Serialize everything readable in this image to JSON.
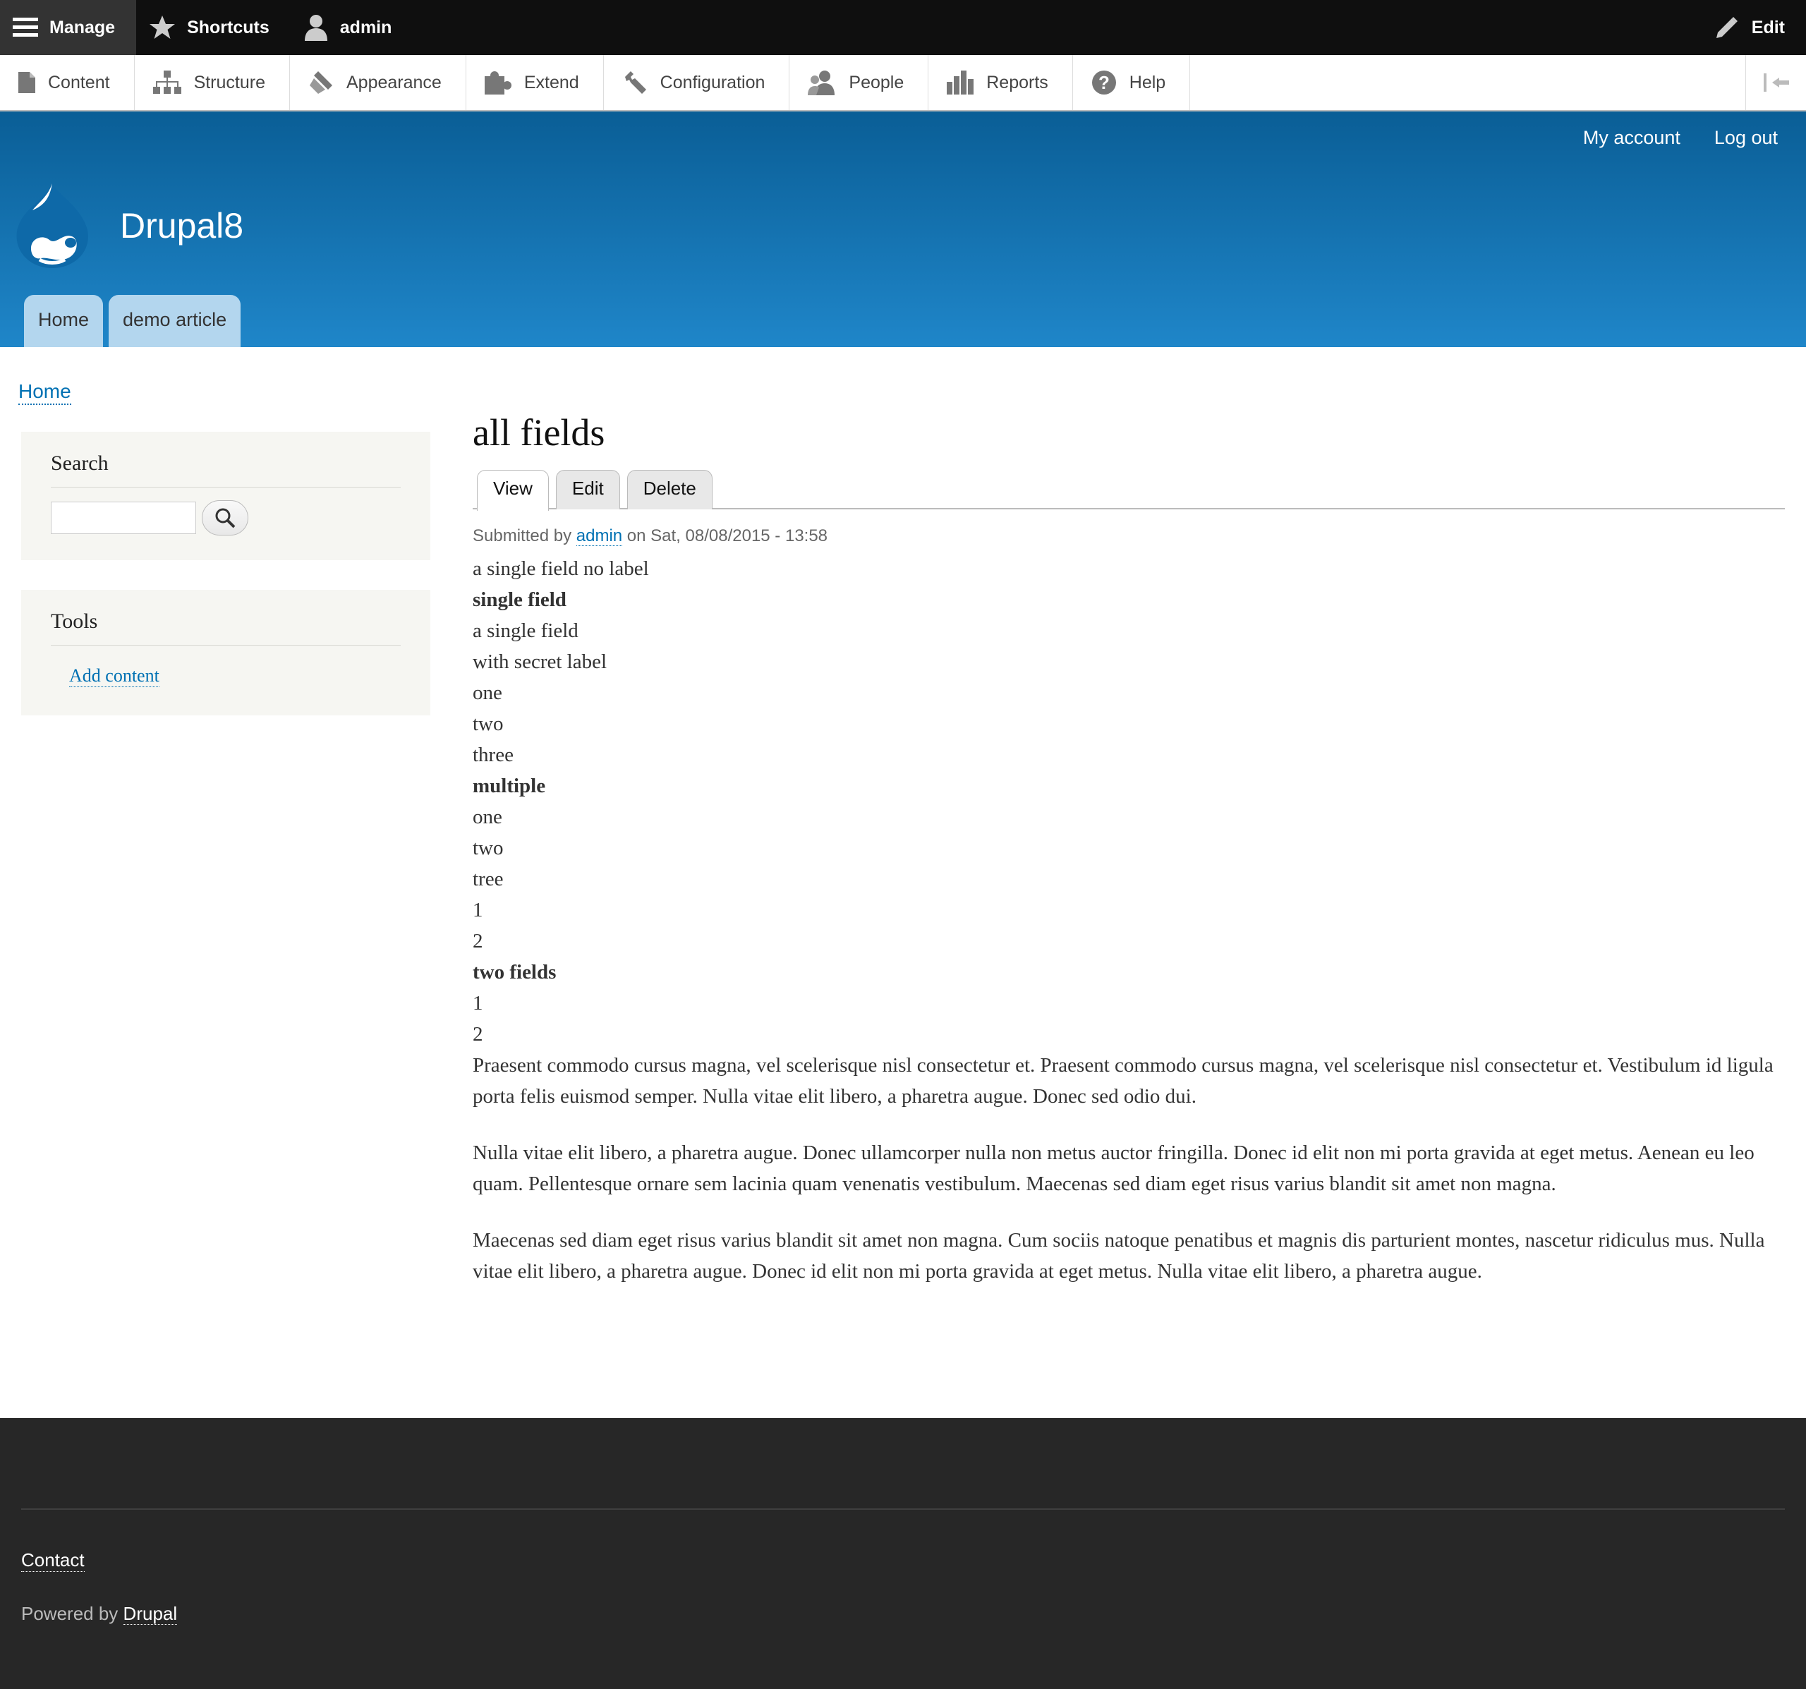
{
  "toolbar": {
    "manage": "Manage",
    "shortcuts": "Shortcuts",
    "user": "admin",
    "edit": "Edit"
  },
  "tray": {
    "items": [
      "Content",
      "Structure",
      "Appearance",
      "Extend",
      "Configuration",
      "People",
      "Reports",
      "Help"
    ]
  },
  "header": {
    "secondary_menu": [
      "My account",
      "Log out"
    ],
    "site_name": "Drupal8",
    "main_menu": [
      "Home",
      "demo article"
    ]
  },
  "breadcrumb": "Home",
  "sidebar": {
    "search_title": "Search",
    "search_value": "",
    "tools_title": "Tools",
    "tools_link": "Add content"
  },
  "main": {
    "title": "all fields",
    "tabs": [
      "View",
      "Edit",
      "Delete"
    ],
    "submitted_prefix": "Submitted by",
    "submitted_author": "admin",
    "submitted_suffix": "on Sat, 08/08/2015 - 13:58",
    "fields": [
      "a single field no label",
      "single field",
      "a single field",
      "with secret label",
      "one",
      "two",
      "three",
      "multiple",
      "one",
      "two",
      "tree",
      "1",
      "2",
      "two fields",
      "1",
      "2"
    ],
    "paragraphs": [
      "Praesent commodo cursus magna, vel scelerisque nisl consectetur et. Praesent commodo cursus magna, vel scelerisque nisl consectetur et. Vestibulum id ligula porta felis euismod semper. Nulla vitae elit libero, a pharetra augue. Donec sed odio dui.",
      "Nulla vitae elit libero, a pharetra augue. Donec ullamcorper nulla non metus auctor fringilla. Donec id elit non mi porta gravida at eget metus. Aenean eu leo quam. Pellentesque ornare sem lacinia quam venenatis vestibulum. Maecenas sed diam eget risus varius blandit sit amet non magna.",
      "Maecenas sed diam eget risus varius blandit sit amet non magna. Cum sociis natoque penatibus et magnis dis parturient montes, nascetur ridiculus mus. Nulla vitae elit libero, a pharetra augue. Donec id elit non mi porta gravida at eget metus. Nulla vitae elit libero, a pharetra augue."
    ]
  },
  "footer": {
    "contact": "Contact",
    "powered_prefix": "Powered by",
    "powered_link": "Drupal"
  }
}
